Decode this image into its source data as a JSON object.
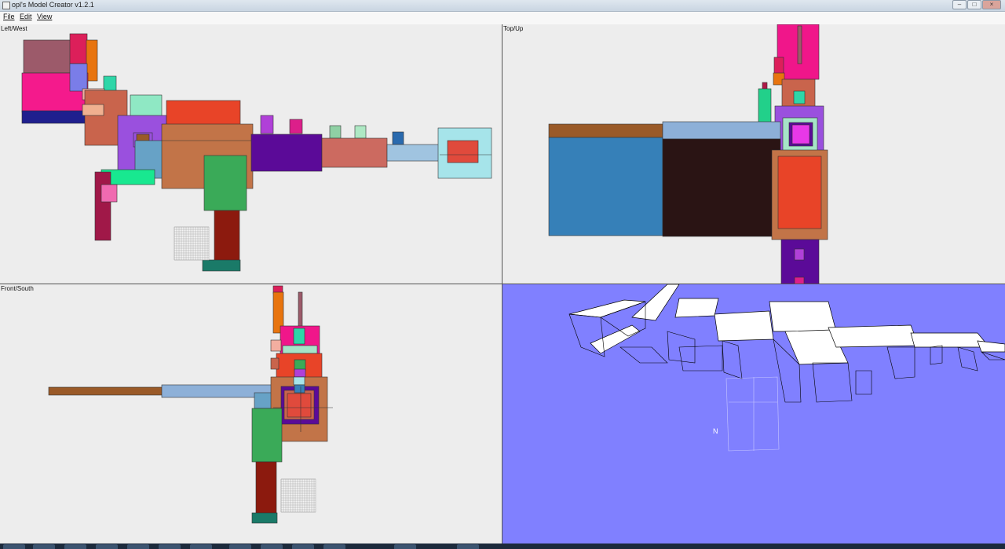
{
  "window": {
    "title": "opl's Model Creator v1.2.1",
    "buttons": {
      "minimize": "–",
      "maximize": "□",
      "close": "×"
    }
  },
  "menu": [
    {
      "id": "file",
      "label": "File"
    },
    {
      "id": "edit",
      "label": "Edit"
    },
    {
      "id": "view",
      "label": "View"
    }
  ],
  "viewports": {
    "left_west": {
      "label": "Left/West"
    },
    "top_up": {
      "label": "Top/Up"
    },
    "front_south": {
      "label": "Front/South"
    },
    "perspective": {
      "label": ""
    }
  },
  "colors": {
    "panel_bg": "#ededed",
    "perspective_bg": "#8080ff",
    "border": "#555555"
  },
  "perspective_marker": "N",
  "taskbar": {
    "icon_count": 13
  }
}
